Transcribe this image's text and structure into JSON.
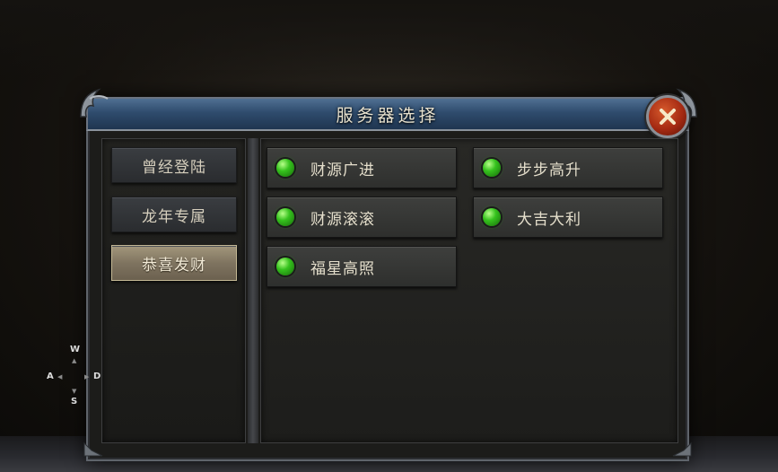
{
  "window": {
    "title": "服务器选择",
    "close_icon": "close-x-icon"
  },
  "categories": [
    {
      "label": "曾经登陆",
      "active": false
    },
    {
      "label": "龙年专属",
      "active": false
    },
    {
      "label": "恭喜发财",
      "active": true
    }
  ],
  "servers": [
    {
      "name": "财源广进",
      "status": "online"
    },
    {
      "name": "步步高升",
      "status": "online"
    },
    {
      "name": "财源滚滚",
      "status": "online"
    },
    {
      "name": "大吉大利",
      "status": "online"
    },
    {
      "name": "福星高照",
      "status": "online"
    }
  ],
  "controls": {
    "up": "W",
    "left": "A",
    "right": "D",
    "down": "S"
  },
  "colors": {
    "title_bar": "#2f4c6d",
    "active_tab": "#7f7460",
    "status_online": "#35c21d",
    "close_button": "#a52a12"
  }
}
